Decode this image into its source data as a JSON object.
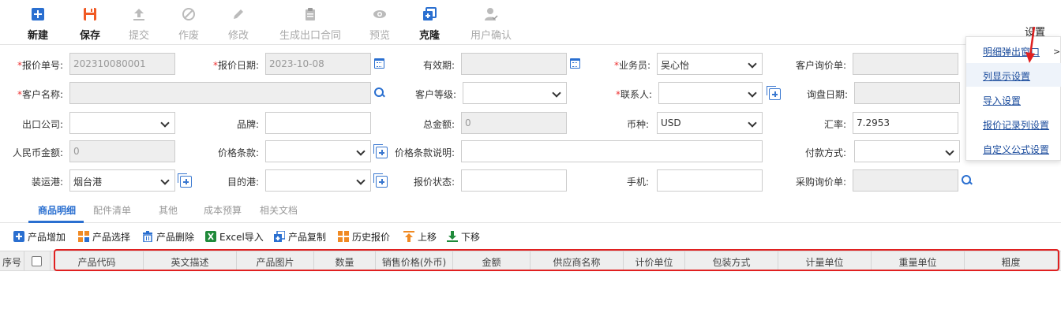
{
  "toolbar": {
    "buttons": [
      {
        "label": "新建",
        "icon": "plus-square-icon",
        "enabled": true
      },
      {
        "label": "保存",
        "icon": "save-icon",
        "enabled": true
      },
      {
        "label": "提交",
        "icon": "upload-icon",
        "enabled": false
      },
      {
        "label": "作废",
        "icon": "ban-icon",
        "enabled": false
      },
      {
        "label": "修改",
        "icon": "pencil-icon",
        "enabled": false
      },
      {
        "label": "生成出口合同",
        "icon": "clipboard-icon",
        "enabled": false
      },
      {
        "label": "预览",
        "icon": "eye-icon",
        "enabled": false
      },
      {
        "label": "克隆",
        "icon": "clone-icon",
        "enabled": true
      },
      {
        "label": "用户确认",
        "icon": "user-check-icon",
        "enabled": false
      }
    ],
    "settings_label": "设置"
  },
  "form": {
    "quote_no_label": "报价单号:",
    "quote_no": "202310080001",
    "quote_date_label": "报价日期:",
    "quote_date": "2023-10-08",
    "validity_label": "有效期:",
    "validity": "",
    "salesperson_label": "业务员:",
    "salesperson": "吴心怡",
    "customer_inquiry_label": "客户询价单:",
    "customer_inquiry": "",
    "customer_name_label": "客户名称:",
    "customer_name": "",
    "customer_level_label": "客户等级:",
    "customer_level": "",
    "contact_label": "联系人:",
    "contact": "",
    "inquiry_date_label": "询盘日期:",
    "inquiry_date": "",
    "export_company_label": "出口公司:",
    "export_company": "",
    "brand_label": "品牌:",
    "brand": "",
    "total_amount_label": "总金额:",
    "total_amount": "0",
    "currency_label": "币种:",
    "currency": "USD",
    "exchange_rate_label": "汇率:",
    "exchange_rate": "7.2953",
    "rmb_amount_label": "人民币金额:",
    "rmb_amount": "0",
    "price_terms_label": "价格条款:",
    "price_terms": "",
    "price_terms_desc_label": "价格条款说明:",
    "price_terms_desc": "",
    "payment_label": "付款方式:",
    "payment": "",
    "loading_port_label": "装运港:",
    "loading_port": "烟台港",
    "dest_port_label": "目的港:",
    "dest_port": "",
    "quote_status_label": "报价状态:",
    "quote_status": "",
    "mobile_label": "手机:",
    "mobile": "",
    "purchase_inquiry_label": "采购询价单:",
    "purchase_inquiry": ""
  },
  "menu": {
    "items": [
      "明细弹出窗口",
      "列显示设置",
      "导入设置",
      "报价记录列设置",
      "自定义公式设置"
    ],
    "arrow": ">"
  },
  "tabs": [
    "商品明细",
    "配件清单",
    "其他",
    "成本预算",
    "相关文档"
  ],
  "actions": [
    {
      "label": "产品增加",
      "icon": "add-icon",
      "color": "#2a6fd0"
    },
    {
      "label": "产品选择",
      "icon": "grid-icon",
      "color": "#f08a24"
    },
    {
      "label": "产品删除",
      "icon": "trash-icon",
      "color": "#2a6fd0"
    },
    {
      "label": "Excel导入",
      "icon": "excel-icon",
      "color": "#1f8a3a"
    },
    {
      "label": "产品复制",
      "icon": "copy-icon",
      "color": "#2a6fd0"
    },
    {
      "label": "历史报价",
      "icon": "history-icon",
      "color": "#f08a24"
    },
    {
      "label": "上移",
      "icon": "move-up-icon",
      "color": "#f08a24"
    },
    {
      "label": "下移",
      "icon": "move-down-icon",
      "color": "#1f8a3a"
    }
  ],
  "grid": {
    "seq_label": "序号",
    "columns": [
      "产品代码",
      "英文描述",
      "产品图片",
      "数量",
      "销售价格(外币)",
      "金额",
      "供应商名称",
      "计价单位",
      "包装方式",
      "计量单位",
      "重量单位",
      "粗度"
    ]
  }
}
